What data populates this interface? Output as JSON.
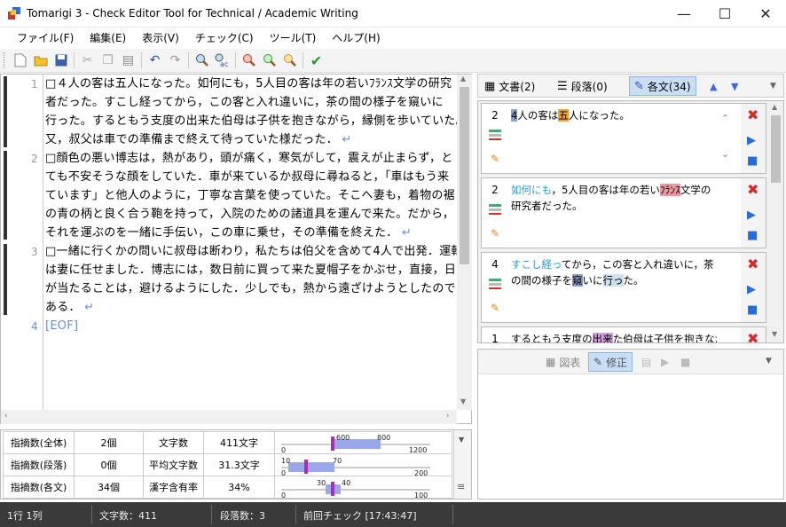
{
  "window": {
    "title": "Tomarigi 3 - Check Editor Tool for Technical / Academic Writing"
  },
  "menu": [
    "ファイル(F)",
    "編集(E)",
    "表示(V)",
    "チェック(C)",
    "ツール(T)",
    "ヘルプ(H)"
  ],
  "editor": {
    "lines": [
      {
        "num": "1",
        "text": "□４人の客は五人になった。如何にも，5人目の客は年の若いﾌﾗﾝｽ文学の研究"
      },
      {
        "num": "",
        "text": "者だった。すこし経ってから，この客と入れ違いに，茶の間の様子を窺いに"
      },
      {
        "num": "",
        "text": "行った。するともう支度の出来た伯母は子供を抱きながら，縁側を歩いていた。"
      },
      {
        "num": "",
        "text": "又，叔父は車での準備まで終えて待っていた様だった．",
        "ret": "↵"
      },
      {
        "num": "2",
        "text": "□顔色の悪い博志は，熱があり，頭が痛く，寒気がして，震えが止まらず，と"
      },
      {
        "num": "",
        "text": "ても不安そうな顔をしていた．車が来ているか叔母に尋ねると，「車はもう来"
      },
      {
        "num": "",
        "text": "ています」と他人のように，丁寧な言葉を使っていた。そこへ妻も，着物の裾"
      },
      {
        "num": "",
        "text": "の青の柄と良く合う鞄を持って，入院のための諸道具を運んで来た。だから，"
      },
      {
        "num": "",
        "text": "それを運ぶのを一緒に手伝い，この車に乗せ，その準備を終えた．",
        "ret": "↵"
      },
      {
        "num": "3",
        "text": "□一緒に行くかの問いに叔母は断わり，私たちは伯父を含めて4人で出発．運転"
      },
      {
        "num": "",
        "text": "は妻に任せました．博志には，数日前に買って来た夏帽子をかぶせ，直接，日"
      },
      {
        "num": "",
        "text": "が当たることは，避けるようにした．少しでも，熱から遠ざけようとしたので"
      },
      {
        "num": "",
        "text": "ある．",
        "ret": "↵"
      },
      {
        "num": "4",
        "text": "[EOF]",
        "eof": true
      }
    ]
  },
  "stats": {
    "rows": [
      {
        "l1": "指摘数(全体)",
        "v1": "2個",
        "l2": "文字数",
        "v2": "411文字",
        "g": {
          "a": "600",
          "b": "800",
          "min": "0",
          "max": "1200",
          "value": 411
        }
      },
      {
        "l1": "指摘数(段落)",
        "v1": "0個",
        "l2": "平均文字数",
        "v2": "31.3文字",
        "g": {
          "a": "10",
          "b": "70",
          "min": "0",
          "max": "200",
          "value": 31.3
        }
      },
      {
        "l1": "指摘数(各文)",
        "v1": "34個",
        "l2": "漢字含有率",
        "v2": "34%",
        "g": {
          "a": "30",
          "b": "40",
          "min": "0",
          "max": "100",
          "value": 34
        }
      }
    ]
  },
  "rtabs": [
    {
      "label": "文書(2)"
    },
    {
      "label": "段落(0)"
    },
    {
      "label": "各文(34)"
    }
  ],
  "cards": [
    {
      "num": "2",
      "segs": [
        {
          "t": "4",
          "c": "hlb"
        },
        {
          "t": "人の客は"
        },
        {
          "t": "五",
          "c": "hlo"
        },
        {
          "t": "人になった。"
        }
      ]
    },
    {
      "num": "2",
      "segs": [
        {
          "t": "如何にも",
          "c": "hlc"
        },
        {
          "t": "，5人目の客は年の若い"
        },
        {
          "t": "ﾌﾗﾝｽ",
          "c": "hlr"
        },
        {
          "t": "文学の研究者だった。"
        }
      ]
    },
    {
      "num": "4",
      "segs": [
        {
          "t": "すこし経っ",
          "c": "hlc"
        },
        {
          "t": "てから，この客と入れ違いに，茶の間の様子を"
        },
        {
          "t": "窺",
          "c": "hlb"
        },
        {
          "t": "いに"
        },
        {
          "t": "行っ",
          "c": "hlg"
        },
        {
          "t": "た。"
        }
      ]
    },
    {
      "num": "1",
      "segs": [
        {
          "t": "するともう支度の"
        },
        {
          "t": "出来",
          "c": "hlp"
        },
        {
          "t": "た伯母は子供を抱きなが"
        }
      ]
    }
  ],
  "rbottom": {
    "figure": "図表",
    "fix": "修正"
  },
  "status": {
    "pos": "1行 1列",
    "chars": "文字数：411",
    "paras": "段落数：3",
    "last": "前回チェック [17:43:47]"
  }
}
